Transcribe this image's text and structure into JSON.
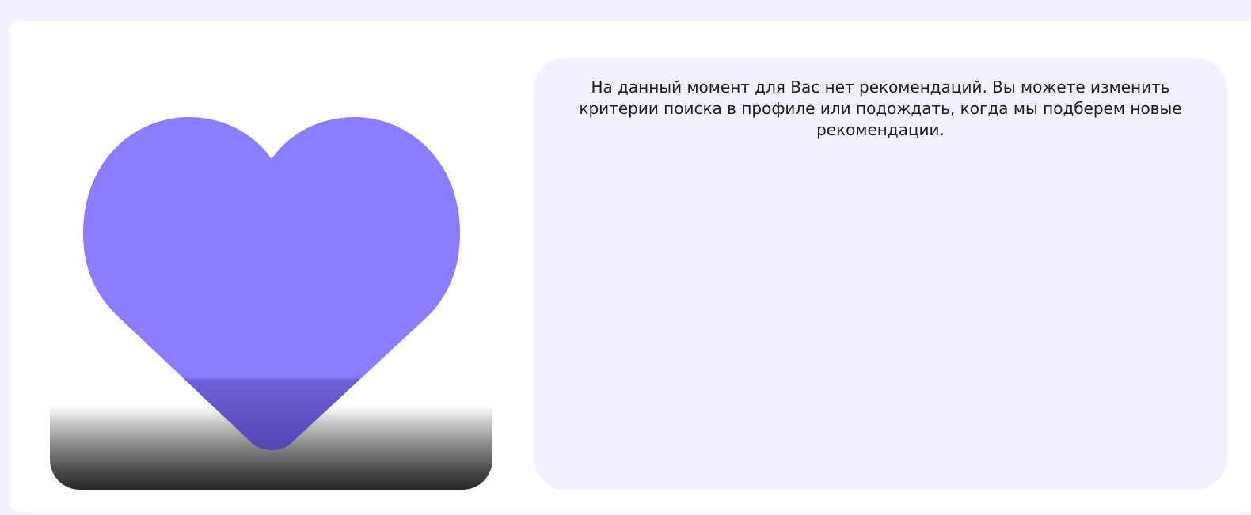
{
  "colors": {
    "page_background": "#f2f1fe",
    "card_background": "#ffffff",
    "panel_background": "#f2f1fe",
    "heart": "#8a7dff",
    "text": "#1d1d1f"
  },
  "illustration": {
    "icon": "heart-icon"
  },
  "message": {
    "text": "На данный момент для Вас нет рекомендаций. Вы можете изменить критерии поиска в профиле или подождать, когда мы подберем новые рекомендации."
  }
}
